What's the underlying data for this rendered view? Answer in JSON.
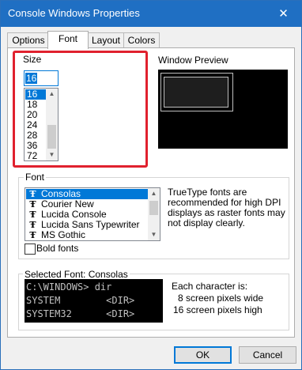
{
  "window": {
    "title": "Console Windows Properties",
    "close_glyph": "✕"
  },
  "tabs": [
    "Options",
    "Font",
    "Layout",
    "Colors"
  ],
  "size": {
    "group_label": "Size",
    "input_value": "16",
    "options": [
      "16",
      "18",
      "20",
      "24",
      "28",
      "36",
      "72"
    ],
    "selected": "16"
  },
  "preview": {
    "label": "Window Preview"
  },
  "font": {
    "group_label": "Font",
    "options": [
      "Consolas",
      "Courier New",
      "Lucida Console",
      "Lucida Sans Typewriter",
      "MS Gothic"
    ],
    "selected": "Consolas",
    "type_glyph": "Ŧ",
    "description": "TrueType fonts are recommended for high DPI displays as raster fonts may not display clearly.",
    "bold_label": "Bold fonts",
    "bold_checked": false
  },
  "selected_font": {
    "label": "Selected Font: Consolas",
    "sample_lines": [
      "C:\\WINDOWS> dir",
      "SYSTEM        <DIR>",
      "SYSTEM32      <DIR>"
    ],
    "char_heading": "Each character is:",
    "width_line": "8 screen pixels wide",
    "height_line": "16 screen pixels high"
  },
  "buttons": {
    "ok": "OK",
    "cancel": "Cancel"
  },
  "colors": {
    "accent": "#0078d7",
    "highlight_box": "#e0212e",
    "titlebar": "#1f6fc3"
  }
}
